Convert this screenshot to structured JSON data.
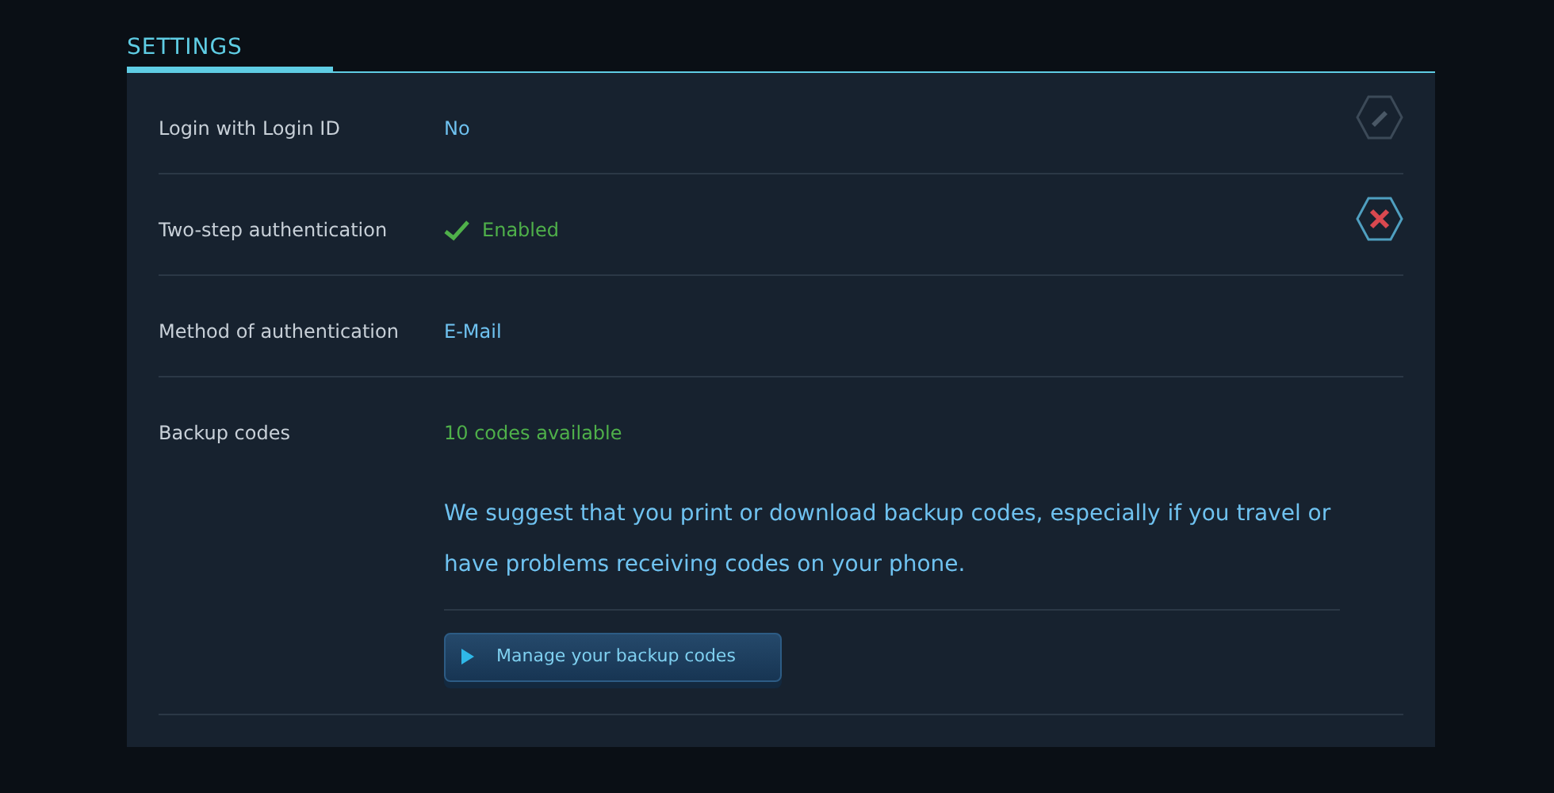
{
  "section_title": "SETTINGS",
  "rows": [
    {
      "label": "Login with Login ID",
      "value": "No",
      "kind": "plain",
      "action": {
        "kind": "edit",
        "disabled": true
      }
    },
    {
      "label": "Two-step authentication",
      "value": "Enabled",
      "kind": "enabled",
      "action": {
        "kind": "remove",
        "disabled": false
      }
    },
    {
      "label": "Method of authentication",
      "value": "E-Mail",
      "kind": "plain"
    },
    {
      "label": "Backup codes",
      "value": "10 codes available",
      "kind": "success",
      "note": "We suggest that you print or download backup codes, especially if you travel or have problems receiving codes on your phone.",
      "button": "Manage your backup codes"
    }
  ]
}
